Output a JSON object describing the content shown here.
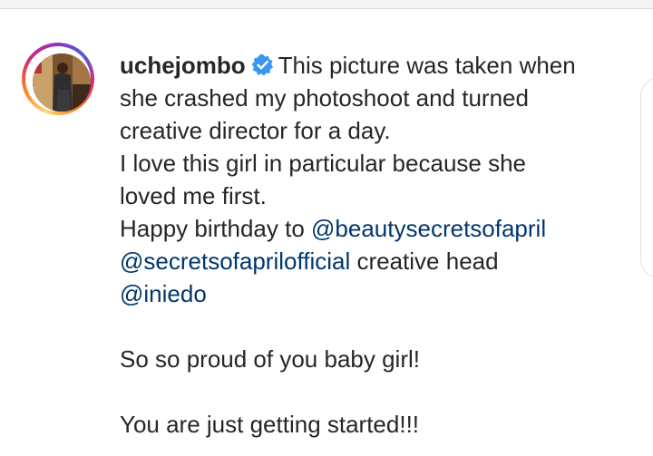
{
  "post": {
    "username": "uchejombo",
    "verified_icon": "verified-badge-icon",
    "caption_lines": [
      "This picture was taken when",
      "she crashed my photoshoot and turned",
      "creative director for a day.",
      "I love this girl in particular because she",
      "loved me first.",
      "Happy birthday to"
    ],
    "mentions": {
      "beautysecrets": "@beautysecretsofapril",
      "secretsofapril": "@secretsofaprilofficial",
      "iniedo": "@iniedo"
    },
    "creative_head_text": " creative head",
    "proud_line": "So so proud of you baby girl!",
    "started_line": "You are just getting started!!!"
  },
  "colors": {
    "text": "#262626",
    "mention": "#00376b",
    "verified": "#3897f0"
  }
}
